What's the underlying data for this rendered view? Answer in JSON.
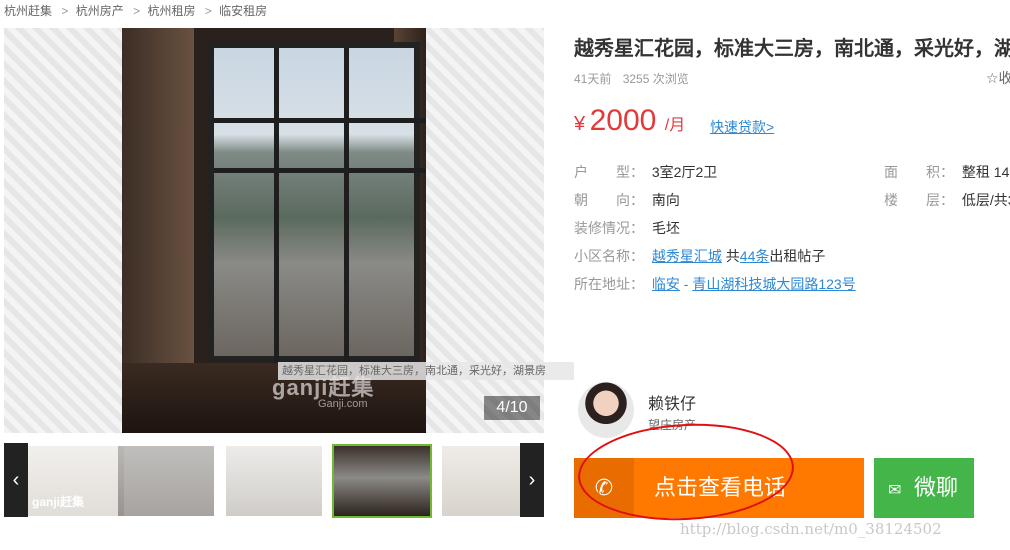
{
  "breadcrumb": [
    "杭州赶集",
    "杭州房产",
    "杭州租房",
    "临安租房"
  ],
  "gallery": {
    "counter": "4/10",
    "caption": "越秀星汇花园，标准大三房，南北通，采光好，湖景房",
    "watermark": "ganji赶集",
    "watermark_sub": "Ganji.com",
    "prev_icon": "chevron-left-icon",
    "next_icon": "chevron-right-icon"
  },
  "listing": {
    "title": "越秀星汇花园，标准大三房，南北通，采光好，湖",
    "posted": "41天前",
    "views": "3255 次浏览",
    "favorite": "☆收",
    "price_currency": "¥",
    "price": "2000",
    "price_unit": "/月",
    "loan_link": "快速贷款>",
    "fields": {
      "layout_key": "户　　型：",
      "layout_val": "3室2厅2卫",
      "area_key": "面　　积：",
      "area_val": "整租  14",
      "orientation_key": "朝　　向：",
      "orientation_val": "南向",
      "floor_key": "楼　　层：",
      "floor_val": "低层/共3",
      "decor_key": "装修情况：",
      "decor_val": "毛坯",
      "community_key": "小区名称：",
      "community_val": "越秀星汇城",
      "community_posts_prefix": " 共",
      "community_posts_count": "44条",
      "community_posts_suffix": "出租帖子",
      "address_key": "所在地址：",
      "address_district": "临安",
      "address_sep": " - ",
      "address_street": "青山湖科技城大园路123号"
    }
  },
  "agent": {
    "name": "赖铁仔",
    "company": "望庄房产",
    "call_label": "点击查看电话",
    "wechat_label": "微聊"
  },
  "overlay": {
    "url": "http://blog.csdn.net/m0_38124502"
  },
  "colors": {
    "price": "#e4393c",
    "link": "#2d88d6",
    "call_button": "#ff7800",
    "wechat_button": "#44b549",
    "annotation": "#e01010"
  }
}
